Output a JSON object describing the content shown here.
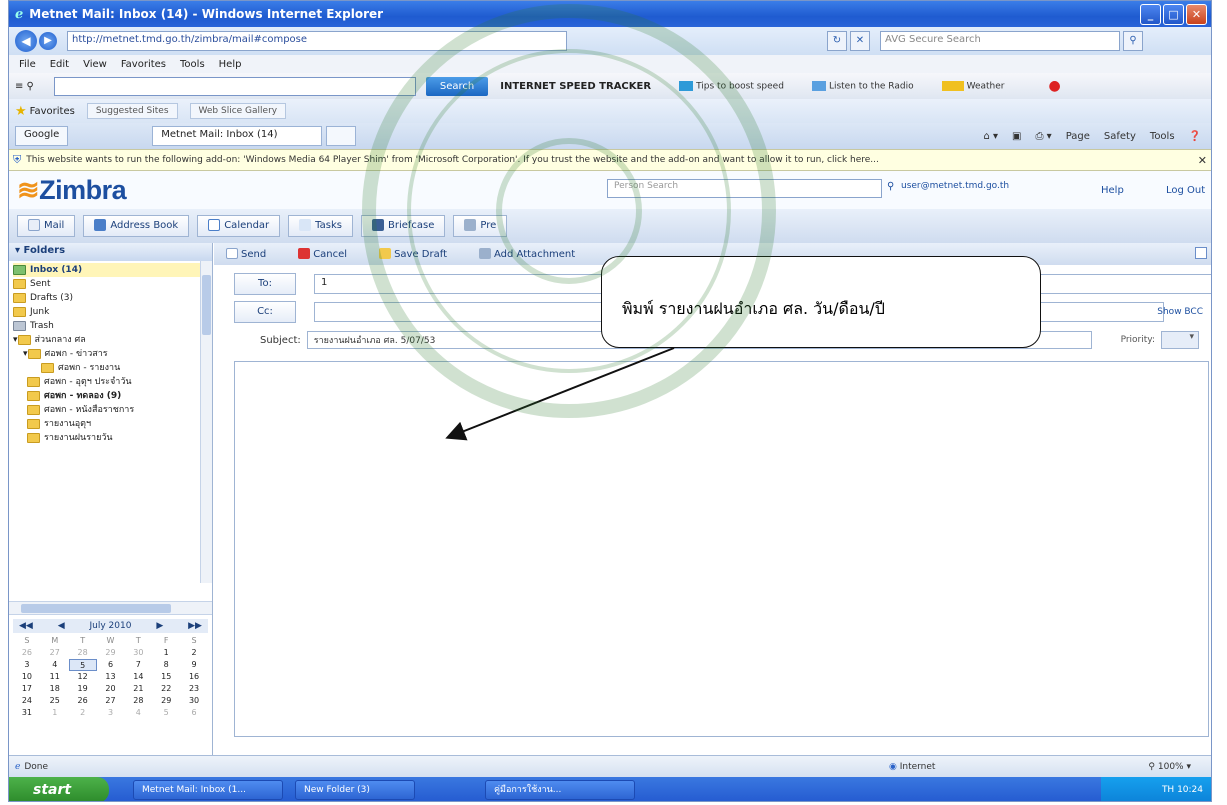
{
  "window": {
    "title": "Metnet Mail: Inbox (14) - Windows Internet Explorer",
    "buttons": [
      "_",
      "□",
      "✕"
    ]
  },
  "address_bar": {
    "url": "http://metnet.tmd.go.th/zimbra/mail#compose",
    "search_placeholder": "AVG Secure Search"
  },
  "menu": [
    "File",
    "Edit",
    "View",
    "Favorites",
    "Tools",
    "Help"
  ],
  "toolbar": {
    "search_button": "Search",
    "title": "INTERNET SPEED TRACKER",
    "items": [
      "Tips to boost speed",
      "Listen to the Radio",
      "Weather"
    ]
  },
  "favorites": {
    "label": "Favorites",
    "links": [
      "Suggested Sites",
      "Web Slice Gallery"
    ]
  },
  "tabs": {
    "google": "Google",
    "active": "Metnet Mail: Inbox (14)"
  },
  "command_bar": [
    "Page",
    "Safety",
    "Tools"
  ],
  "infobar": {
    "text": "This website wants to run the following add-on: 'Windows Media 64 Player Shim' from 'Microsoft Corporation'. If you trust the website and the add-on and want to allow it to run, click here..."
  },
  "zimbra": {
    "logo": "Zimbra",
    "search_placeholder": "Person Search",
    "user": "user@metnet.tmd.go.th",
    "help": "Help",
    "logout": "Log Out",
    "app_tabs": [
      "Mail",
      "Address Book",
      "Calendar",
      "Tasks",
      "Briefcase",
      "Pre"
    ]
  },
  "folders": {
    "header": "Folders",
    "items": [
      "Inbox (14)",
      "Sent",
      "Drafts (3)",
      "Junk",
      "Trash",
      "ส่วนกลาง ศล",
      "ศอพก - ข่าวสาร",
      "ศอพก - รายงาน",
      "ศอพก - อุตุฯ ประจำวัน",
      "ศอพก - ทดลอง (9)",
      "ศอพก - หนังสือราชการ",
      "รายงานอุตุฯ",
      "รายงานฝนรายวัน"
    ]
  },
  "calendar": {
    "month": "July 2010",
    "dow": [
      "S",
      "M",
      "T",
      "W",
      "T",
      "F",
      "S"
    ],
    "weeks": [
      [
        "26",
        "27",
        "28",
        "29",
        "30",
        "1",
        "2"
      ],
      [
        "3",
        "4",
        "5",
        "6",
        "7",
        "8",
        "9"
      ],
      [
        "10",
        "11",
        "12",
        "13",
        "14",
        "15",
        "16"
      ],
      [
        "17",
        "18",
        "19",
        "20",
        "21",
        "22",
        "23"
      ],
      [
        "24",
        "25",
        "26",
        "27",
        "28",
        "29",
        "30"
      ],
      [
        "31",
        "1",
        "2",
        "3",
        "4",
        "5",
        "6"
      ]
    ],
    "today": "5"
  },
  "compose": {
    "toolbar": [
      "Send",
      "Cancel",
      "Save Draft",
      "Add Attachment"
    ],
    "to_label": "To:",
    "to_value": "1",
    "cc_label": "Cc:",
    "show_bcc": "Show BCC",
    "subject_label": "Subject:",
    "subject_value": "รายงานฝนอำเภอ ศล. 5/07/53",
    "priority_label": "Priority:"
  },
  "callout": {
    "text": "พิมพ์  รายงานฝนอำเภอ ศล. วัน/ดือน/ปี"
  },
  "statusbar": {
    "left": "Done",
    "zone": "Internet",
    "zoom": "100%"
  },
  "taskbar": {
    "start": "start",
    "items": [
      "Metnet Mail: Inbox (1...",
      "New Folder (3)",
      "คู่มือการใช้งาน..."
    ],
    "clock": "TH  10:24"
  }
}
